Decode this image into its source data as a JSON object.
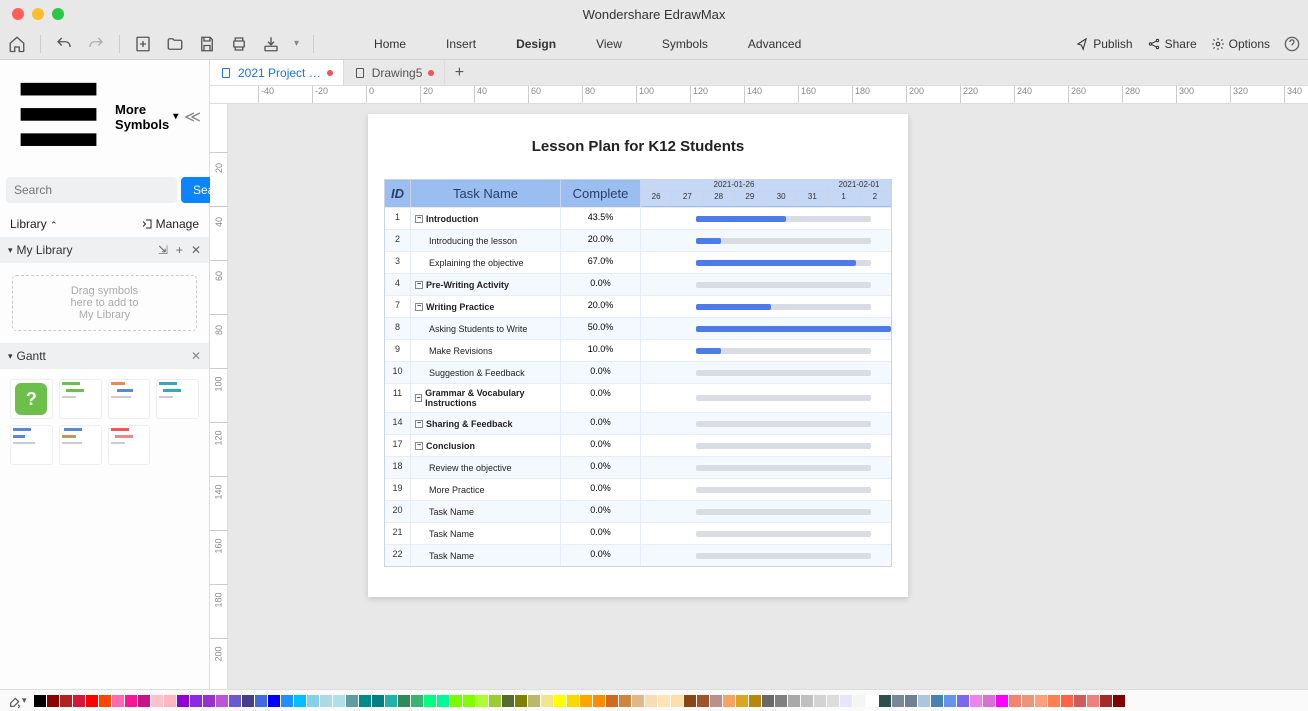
{
  "app": {
    "title": "Wondershare EdrawMax"
  },
  "toolbar": {
    "menus": [
      "Home",
      "Insert",
      "Design",
      "View",
      "Symbols",
      "Advanced"
    ],
    "active_menu": "Design",
    "publish": "Publish",
    "share": "Share",
    "options": "Options"
  },
  "sidebar": {
    "title": "More Symbols",
    "search_placeholder": "Search",
    "search_button": "Search",
    "library_label": "Library",
    "manage_label": "Manage",
    "mylib_label": "My Library",
    "dropzone": "Drag symbols\nhere to add to\nMy Library",
    "gantt_label": "Gantt"
  },
  "tabs": [
    {
      "label": "2021 Project …",
      "active": true,
      "dirty": true,
      "color": "#1a73e8"
    },
    {
      "label": "Drawing5",
      "active": false,
      "dirty": true,
      "color": "#555"
    }
  ],
  "hruler": [
    -40,
    -20,
    0,
    20,
    40,
    60,
    80,
    100,
    120,
    140,
    160,
    180,
    200,
    220,
    240,
    260,
    280,
    300,
    320,
    340
  ],
  "vruler": [
    20,
    40,
    60,
    80,
    100,
    120,
    140,
    160,
    180,
    200
  ],
  "document": {
    "title": "Lesson Plan for K12 Students",
    "headers": {
      "id": "ID",
      "task": "Task Name",
      "complete": "Complete"
    },
    "dates": [
      "2021-01-26",
      "2021-02-01"
    ],
    "days": [
      "26",
      "27",
      "28",
      "29",
      "30",
      "31",
      "1",
      "2"
    ],
    "rows": [
      {
        "id": 1,
        "task": "Introduction",
        "bold": true,
        "exp": true,
        "complete": "43.5%",
        "bg_l": 22,
        "bg_w": 70,
        "fg_l": 22,
        "fg_w": 36
      },
      {
        "id": 2,
        "task": "Introducing the lesson",
        "bold": false,
        "indent": true,
        "complete": "20.0%",
        "bg_l": 22,
        "bg_w": 70,
        "fg_l": 22,
        "fg_w": 10
      },
      {
        "id": 3,
        "task": "Explaining the objective",
        "bold": false,
        "indent": true,
        "complete": "67.0%",
        "bg_l": 22,
        "bg_w": 70,
        "fg_l": 22,
        "fg_w": 64
      },
      {
        "id": 4,
        "task": "Pre-Writing Activity",
        "bold": true,
        "exp": true,
        "complete": "0.0%",
        "bg_l": 22,
        "bg_w": 70,
        "fg_l": 22,
        "fg_w": 0
      },
      {
        "id": 7,
        "task": "Writing Practice",
        "bold": true,
        "exp": true,
        "complete": "20.0%",
        "bg_l": 22,
        "bg_w": 70,
        "fg_l": 22,
        "fg_w": 30
      },
      {
        "id": 8,
        "task": "Asking Students to Write",
        "bold": false,
        "indent": true,
        "complete": "50.0%",
        "bg_l": 22,
        "bg_w": 78,
        "fg_l": 22,
        "fg_w": 78
      },
      {
        "id": 9,
        "task": "Make Revisions",
        "bold": false,
        "indent": true,
        "complete": "10.0%",
        "bg_l": 22,
        "bg_w": 70,
        "fg_l": 22,
        "fg_w": 10
      },
      {
        "id": 10,
        "task": "Suggestion & Feedback",
        "bold": false,
        "indent": true,
        "complete": "0.0%",
        "bg_l": 22,
        "bg_w": 70,
        "fg_l": 22,
        "fg_w": 0
      },
      {
        "id": 11,
        "task": "Grammar & Vocabulary Instructions",
        "bold": true,
        "exp": true,
        "complete": "0.0%",
        "bg_l": 22,
        "bg_w": 70,
        "fg_l": 22,
        "fg_w": 0
      },
      {
        "id": 14,
        "task": "Sharing & Feedback",
        "bold": true,
        "exp": true,
        "complete": "0.0%",
        "bg_l": 22,
        "bg_w": 70,
        "fg_l": 22,
        "fg_w": 0
      },
      {
        "id": 17,
        "task": "Conclusion",
        "bold": true,
        "exp": true,
        "complete": "0.0%",
        "bg_l": 22,
        "bg_w": 70,
        "fg_l": 22,
        "fg_w": 0
      },
      {
        "id": 18,
        "task": "Review the objective",
        "bold": false,
        "indent": true,
        "complete": "0.0%",
        "bg_l": 22,
        "bg_w": 70,
        "fg_l": 22,
        "fg_w": 0
      },
      {
        "id": 19,
        "task": "More Practice",
        "bold": false,
        "indent": true,
        "complete": "0.0%",
        "bg_l": 22,
        "bg_w": 70,
        "fg_l": 22,
        "fg_w": 0
      },
      {
        "id": 20,
        "task": "Task Name",
        "bold": false,
        "indent": true,
        "complete": "0.0%",
        "bg_l": 22,
        "bg_w": 70,
        "fg_l": 22,
        "fg_w": 0
      },
      {
        "id": 21,
        "task": "Task Name",
        "bold": false,
        "indent": true,
        "complete": "0.0%",
        "bg_l": 22,
        "bg_w": 70,
        "fg_l": 22,
        "fg_w": 0
      },
      {
        "id": 22,
        "task": "Task Name",
        "bold": false,
        "indent": true,
        "complete": "0.0%",
        "bg_l": 22,
        "bg_w": 70,
        "fg_l": 22,
        "fg_w": 0
      }
    ]
  },
  "colors": [
    "#000000",
    "#8B0000",
    "#B22222",
    "#DC143C",
    "#FF0000",
    "#FF4500",
    "#FF69B4",
    "#FF1493",
    "#C71585",
    "#FFC0CB",
    "#FFB6C1",
    "#9400D3",
    "#8A2BE2",
    "#9932CC",
    "#BA55D3",
    "#6A5ACD",
    "#483D8B",
    "#4169E1",
    "#0000FF",
    "#1E90FF",
    "#00BFFF",
    "#87CEEB",
    "#ADD8E6",
    "#B0E0E6",
    "#5F9EA0",
    "#008B8B",
    "#008080",
    "#20B2AA",
    "#2E8B57",
    "#3CB371",
    "#00FF7F",
    "#00FA9A",
    "#7CFC00",
    "#7FFF00",
    "#ADFF2F",
    "#9ACD32",
    "#556B2F",
    "#808000",
    "#BDB76B",
    "#F0E68C",
    "#FFFF00",
    "#FFD700",
    "#FFA500",
    "#FF8C00",
    "#D2691E",
    "#CD853F",
    "#DEB887",
    "#F5DEB3",
    "#FFE4B5",
    "#FFDEAD",
    "#8B4513",
    "#A0522D",
    "#BC8F8F",
    "#F4A460",
    "#DAA520",
    "#B8860B",
    "#696969",
    "#808080",
    "#A9A9A9",
    "#C0C0C0",
    "#D3D3D3",
    "#DCDCDC",
    "#E6E6FA",
    "#F5F5F5",
    "#FFFFFF",
    "#2F4F4F",
    "#778899",
    "#708090",
    "#B0C4DE",
    "#4682B4",
    "#6495ED",
    "#7B68EE",
    "#EE82EE",
    "#DA70D6",
    "#FF00FF",
    "#FA8072",
    "#E9967A",
    "#FFA07A",
    "#FF7F50",
    "#FF6347",
    "#CD5C5C",
    "#F08080",
    "#A52A2A",
    "#800000"
  ]
}
